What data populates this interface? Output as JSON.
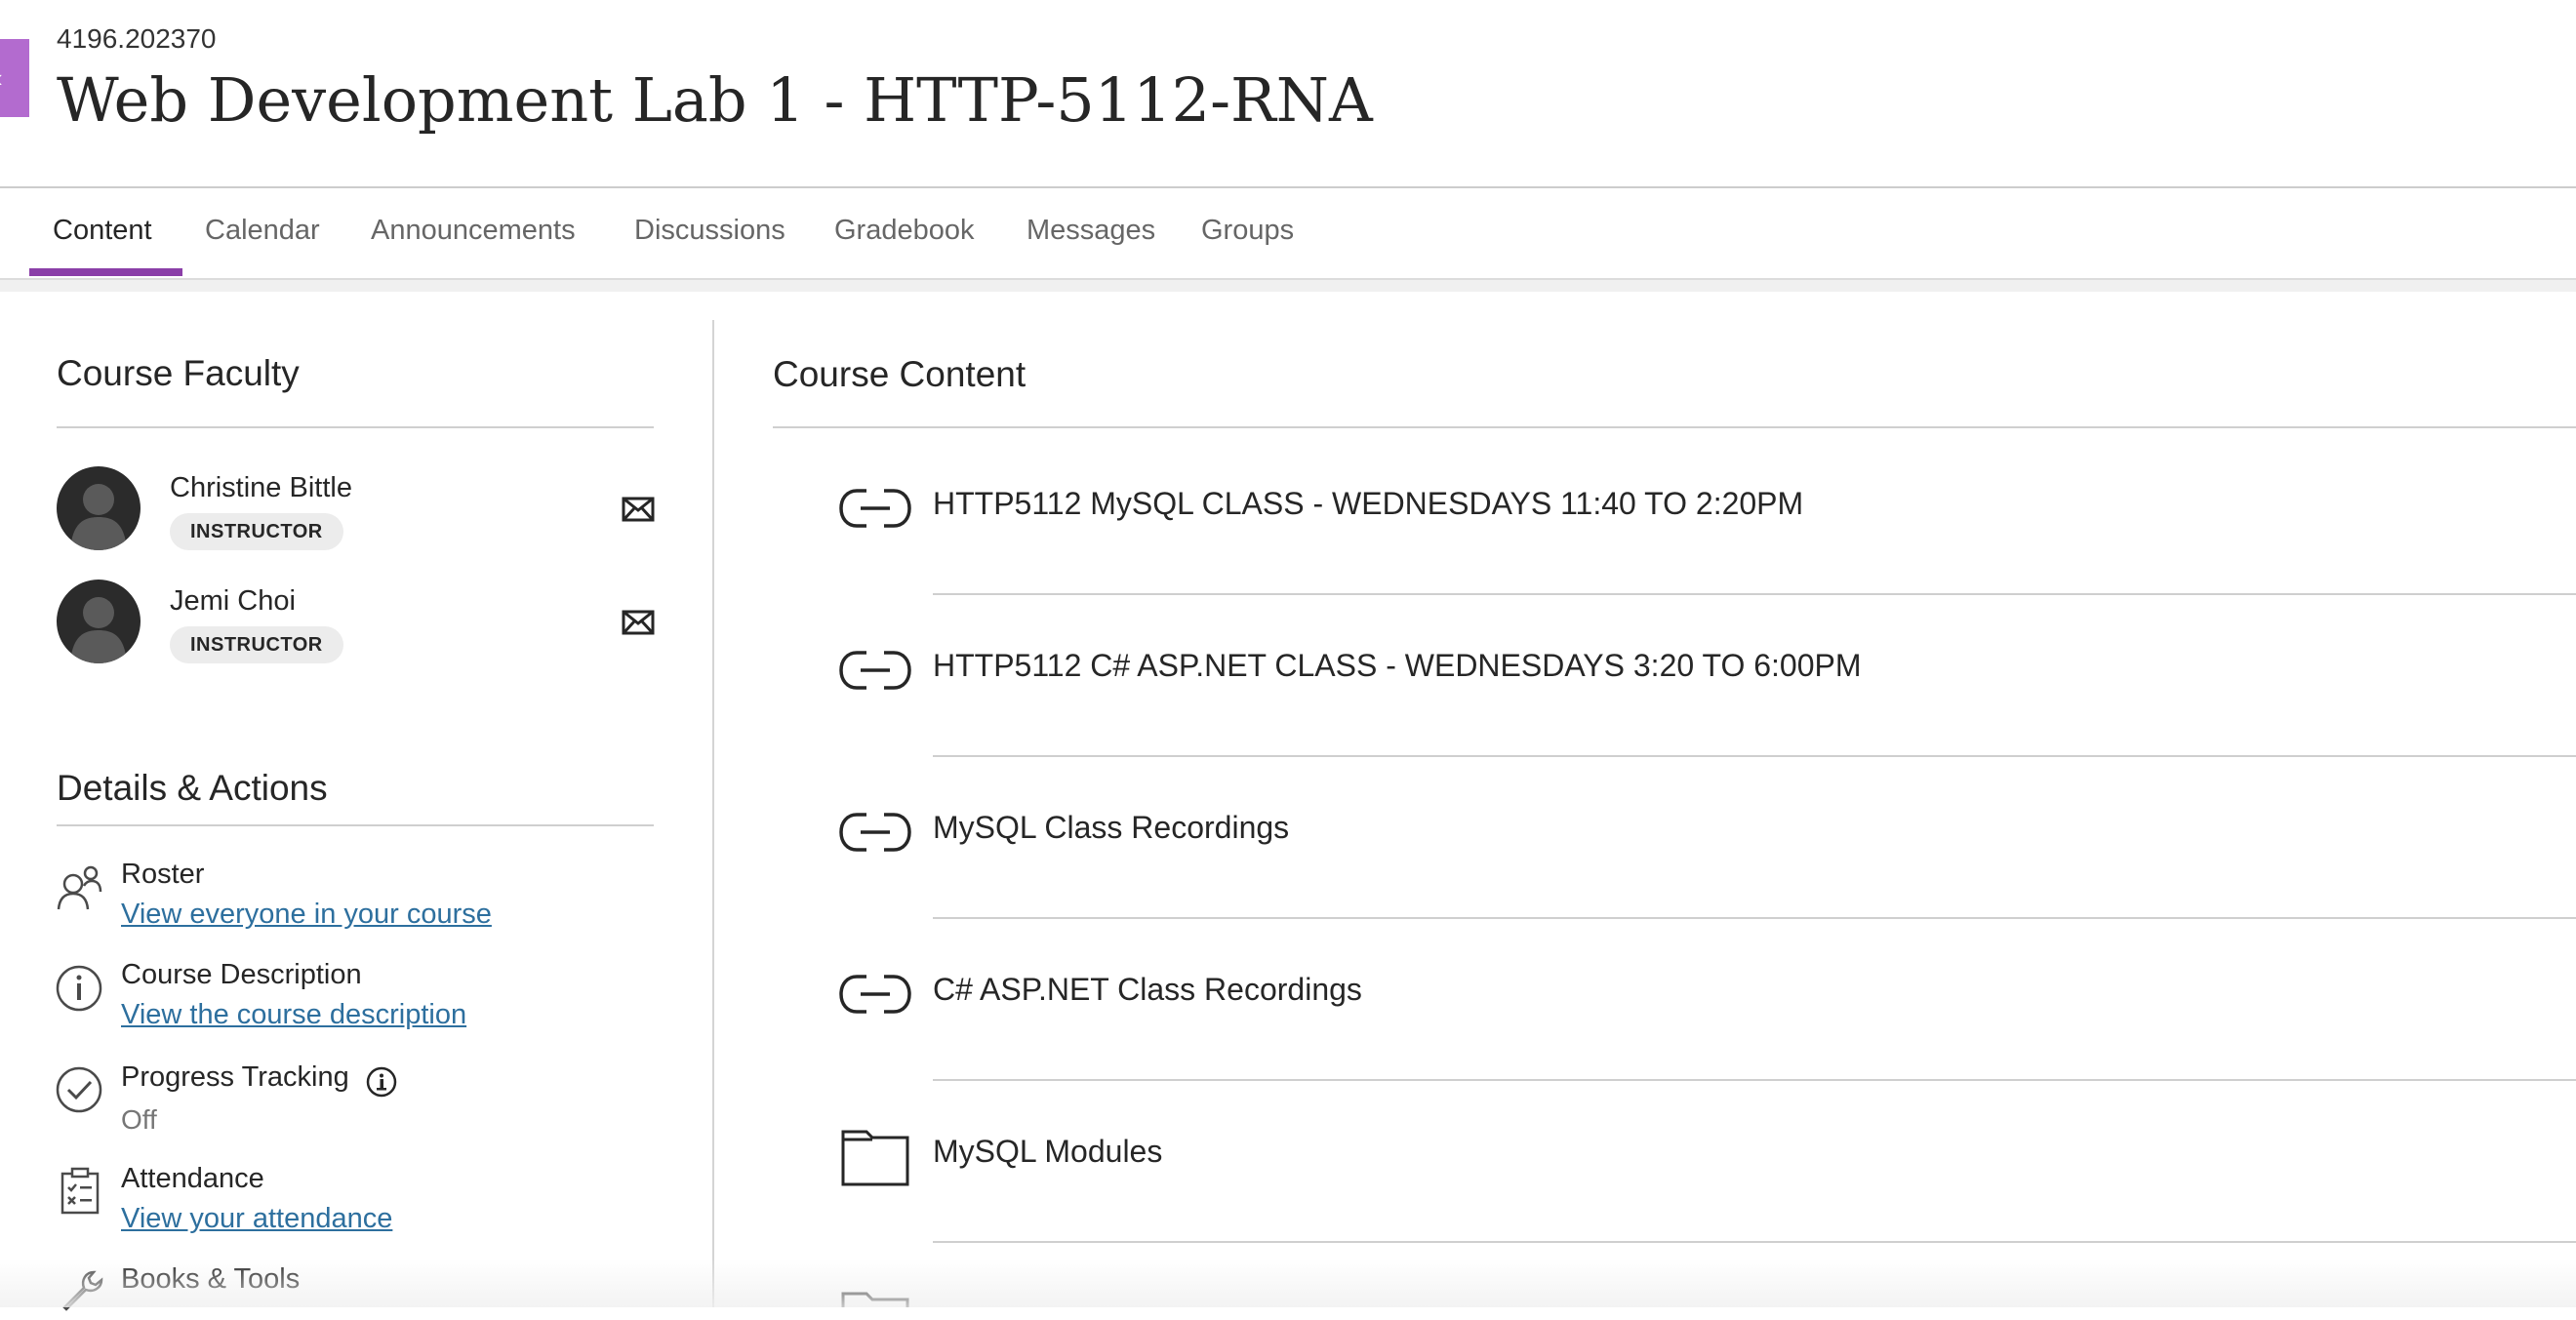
{
  "header": {
    "course_id": "4196.202370",
    "course_title": "Web Development Lab 1 - HTTP-5112-RNA"
  },
  "tabs": [
    {
      "label": "Content",
      "active": true
    },
    {
      "label": "Calendar",
      "active": false
    },
    {
      "label": "Announcements",
      "active": false
    },
    {
      "label": "Discussions",
      "active": false
    },
    {
      "label": "Gradebook",
      "active": false
    },
    {
      "label": "Messages",
      "active": false
    },
    {
      "label": "Groups",
      "active": false
    }
  ],
  "faculty": {
    "heading": "Course Faculty",
    "members": [
      {
        "name": "Christine Bittle",
        "role": "INSTRUCTOR"
      },
      {
        "name": "Jemi Choi",
        "role": "INSTRUCTOR"
      }
    ]
  },
  "details": {
    "heading": "Details & Actions",
    "roster": {
      "title": "Roster",
      "link": "View everyone in your course"
    },
    "description": {
      "title": "Course Description",
      "link": "View the course description"
    },
    "progress": {
      "title": "Progress Tracking",
      "value": "Off"
    },
    "attendance": {
      "title": "Attendance",
      "link": "View your attendance"
    },
    "books": {
      "title": "Books & Tools"
    }
  },
  "content": {
    "heading": "Course Content",
    "items": [
      {
        "title": "HTTP5112 MySQL CLASS - WEDNESDAYS 11:40 TO 2:20PM",
        "icon": "link-icon"
      },
      {
        "title": "HTTP5112 C# ASP.NET CLASS - WEDNESDAYS 3:20 TO 6:00PM",
        "icon": "link-icon"
      },
      {
        "title": "MySQL Class Recordings",
        "icon": "link-icon"
      },
      {
        "title": "C# ASP.NET Class Recordings",
        "icon": "link-icon"
      },
      {
        "title": "MySQL Modules",
        "icon": "folder-icon"
      }
    ]
  },
  "colors": {
    "accent": "#8b3fa8",
    "side_toggle": "#b36bcf",
    "link": "#2d6f9e"
  }
}
